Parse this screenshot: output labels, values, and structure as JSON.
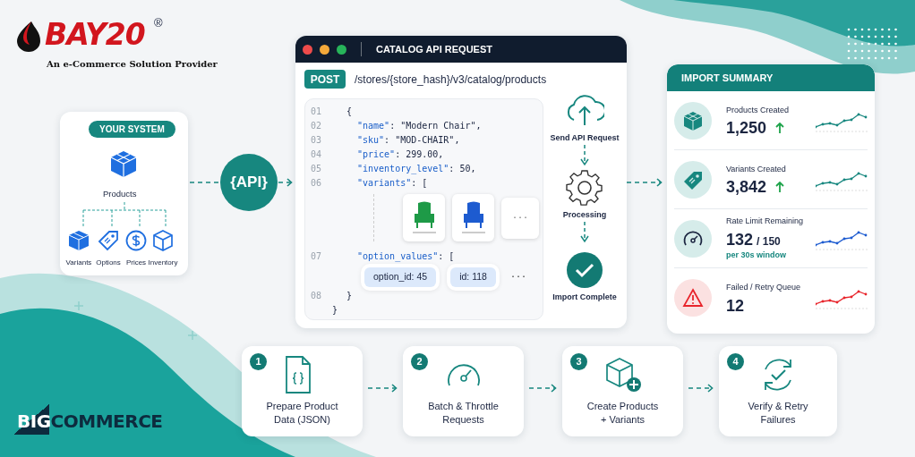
{
  "logo": {
    "brand": "BAY20",
    "registered": "®",
    "tagline": "An e-Commerce Solution Provider"
  },
  "your_system": {
    "badge": "YOUR SYSTEM",
    "root": "Products",
    "children": [
      {
        "label": "Variants",
        "kind": "boxes"
      },
      {
        "label": "Options",
        "kind": "tag"
      },
      {
        "label": "Prices",
        "kind": "dollar"
      },
      {
        "label": "Inventory",
        "kind": "box"
      }
    ]
  },
  "api_badge": "{API}",
  "request_window": {
    "title": "CATALOG API REQUEST",
    "method": "POST",
    "endpoint": "/stores/{store_hash}/v3/catalog/products",
    "code_lines": [
      {
        "number": "01",
        "kind": "plain",
        "text": "{"
      },
      {
        "number": "02",
        "kind": "prop",
        "key": "\"name\"",
        "value": ": \"Modern Chair\","
      },
      {
        "number": "03",
        "kind": "prop",
        "key": "\"sku\"",
        "value": ": \"MOD-CHAIR\","
      },
      {
        "number": "04",
        "kind": "prop",
        "key": "\"price\"",
        "value": ": 299.00,"
      },
      {
        "number": "05",
        "kind": "prop",
        "key": "\"inventory_level\"",
        "value": ": 50,"
      },
      {
        "number": "06",
        "kind": "prop",
        "key": "\"variants\"",
        "value": ": ["
      },
      {
        "kind": "variants"
      },
      {
        "number": "07",
        "kind": "prop",
        "key": "\"option_values\"",
        "value": ": ["
      },
      {
        "kind": "options"
      },
      {
        "number": "08",
        "kind": "plain",
        "text": "}"
      },
      {
        "kind": "plain",
        "text": "}"
      }
    ],
    "variants": [
      {
        "color": "#1e9a47"
      },
      {
        "color": "#1d5bd0"
      }
    ],
    "variants_more": "···",
    "option_values": [
      "option_id: 45",
      "id: 118"
    ],
    "options_more": "···"
  },
  "flow": [
    {
      "label": "Send API Request",
      "kind": "cloud"
    },
    {
      "label": "Processing",
      "kind": "gear"
    },
    {
      "label": "Import Complete",
      "kind": "check"
    }
  ],
  "summary": {
    "title": "IMPORT SUMMARY",
    "metrics": [
      {
        "label": "Products Created",
        "value": "1,250",
        "rising": true,
        "kind": "box",
        "color": "#17877f"
      },
      {
        "label": "Variants Created",
        "value": "3,842",
        "rising": true,
        "kind": "tag",
        "color": "#17877f"
      },
      {
        "label": "Rate Limit Remaining",
        "value": "132",
        "total": "/ 150",
        "note": "per 30s window",
        "kind": "gauge",
        "color": "#1d5bd0"
      },
      {
        "label": "Failed / Retry Queue",
        "value": "12",
        "kind": "warning",
        "color": "#e8242b"
      }
    ]
  },
  "steps": [
    {
      "number": "1",
      "label": "Prepare Product\nData (JSON)",
      "kind": "file"
    },
    {
      "number": "2",
      "label": "Batch & Throttle\nRequests",
      "kind": "gauge"
    },
    {
      "number": "3",
      "label": "Create Products\n+ Variants",
      "kind": "cube"
    },
    {
      "number": "4",
      "label": "Verify & Retry\nFailures",
      "kind": "retry"
    }
  ],
  "partner_logo": {
    "lead": "BIG",
    "rest": "COMMERCE"
  }
}
